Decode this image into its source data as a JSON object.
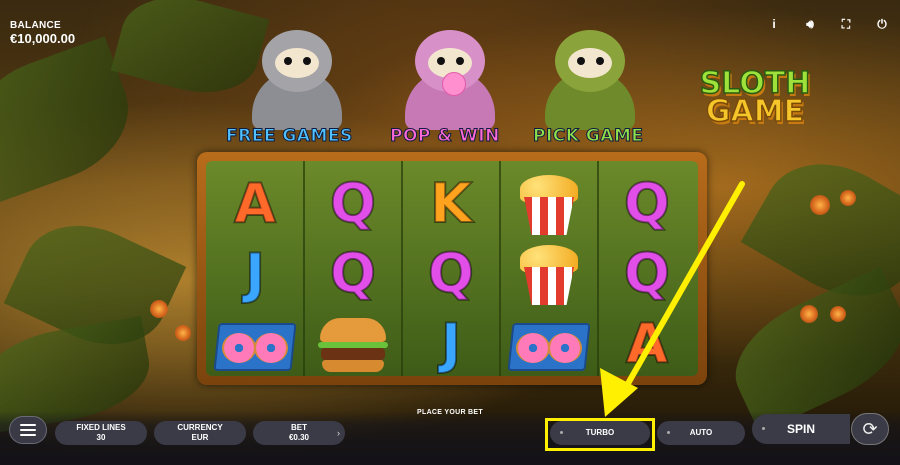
{
  "balance": {
    "label": "BALANCE",
    "value": "€10,000.00"
  },
  "top_icons": [
    {
      "name": "info-icon",
      "glyph": "i"
    },
    {
      "name": "sound-icon",
      "glyph": "🔊︎"
    },
    {
      "name": "fullscreen-icon",
      "glyph": "⛶"
    },
    {
      "name": "power-icon",
      "glyph": "⏻"
    }
  ],
  "logo": {
    "line1": "SLOTH",
    "line2": "GAME"
  },
  "features": [
    {
      "label": "FREE GAMES",
      "color": "#4fc2ff",
      "fur": "#a3a3a8"
    },
    {
      "label": "POP & WIN",
      "color": "#ff6ad5",
      "fur": "#d890c8"
    },
    {
      "label": "PICK GAME",
      "color": "#8fe04a",
      "fur": "#8aa33a"
    }
  ],
  "reels": [
    [
      {
        "type": "letter",
        "text": "A",
        "color": "#ff6a2a"
      },
      {
        "type": "letter",
        "text": "J",
        "color": "#3aa6ff"
      },
      {
        "type": "donut"
      }
    ],
    [
      {
        "type": "letter",
        "text": "Q",
        "color": "#e24fe8"
      },
      {
        "type": "letter",
        "text": "Q",
        "color": "#e24fe8"
      },
      {
        "type": "burger"
      }
    ],
    [
      {
        "type": "letter",
        "text": "K",
        "color": "#ffa21e"
      },
      {
        "type": "letter",
        "text": "Q",
        "color": "#e24fe8"
      },
      {
        "type": "letter",
        "text": "J",
        "color": "#3aa6ff"
      }
    ],
    [
      {
        "type": "popcorn"
      },
      {
        "type": "popcorn"
      },
      {
        "type": "donut"
      }
    ],
    [
      {
        "type": "letter",
        "text": "Q",
        "color": "#e24fe8"
      },
      {
        "type": "letter",
        "text": "Q",
        "color": "#e24fe8"
      },
      {
        "type": "letter",
        "text": "A",
        "color": "#ff6a2a"
      }
    ]
  ],
  "controls": {
    "place_bet": "PLACE YOUR BET",
    "fixed_lines": {
      "label": "FIXED LINES",
      "value": "30"
    },
    "currency": {
      "label": "CURRENCY",
      "value": "EUR"
    },
    "bet": {
      "label": "BET",
      "value": "€0.30"
    },
    "more_glyph": "›",
    "turbo": "TURBO",
    "auto": "AUTO",
    "spin": "SPIN",
    "autospin_glyph": "⟳"
  },
  "annotation": {
    "color": "#ffef00"
  }
}
